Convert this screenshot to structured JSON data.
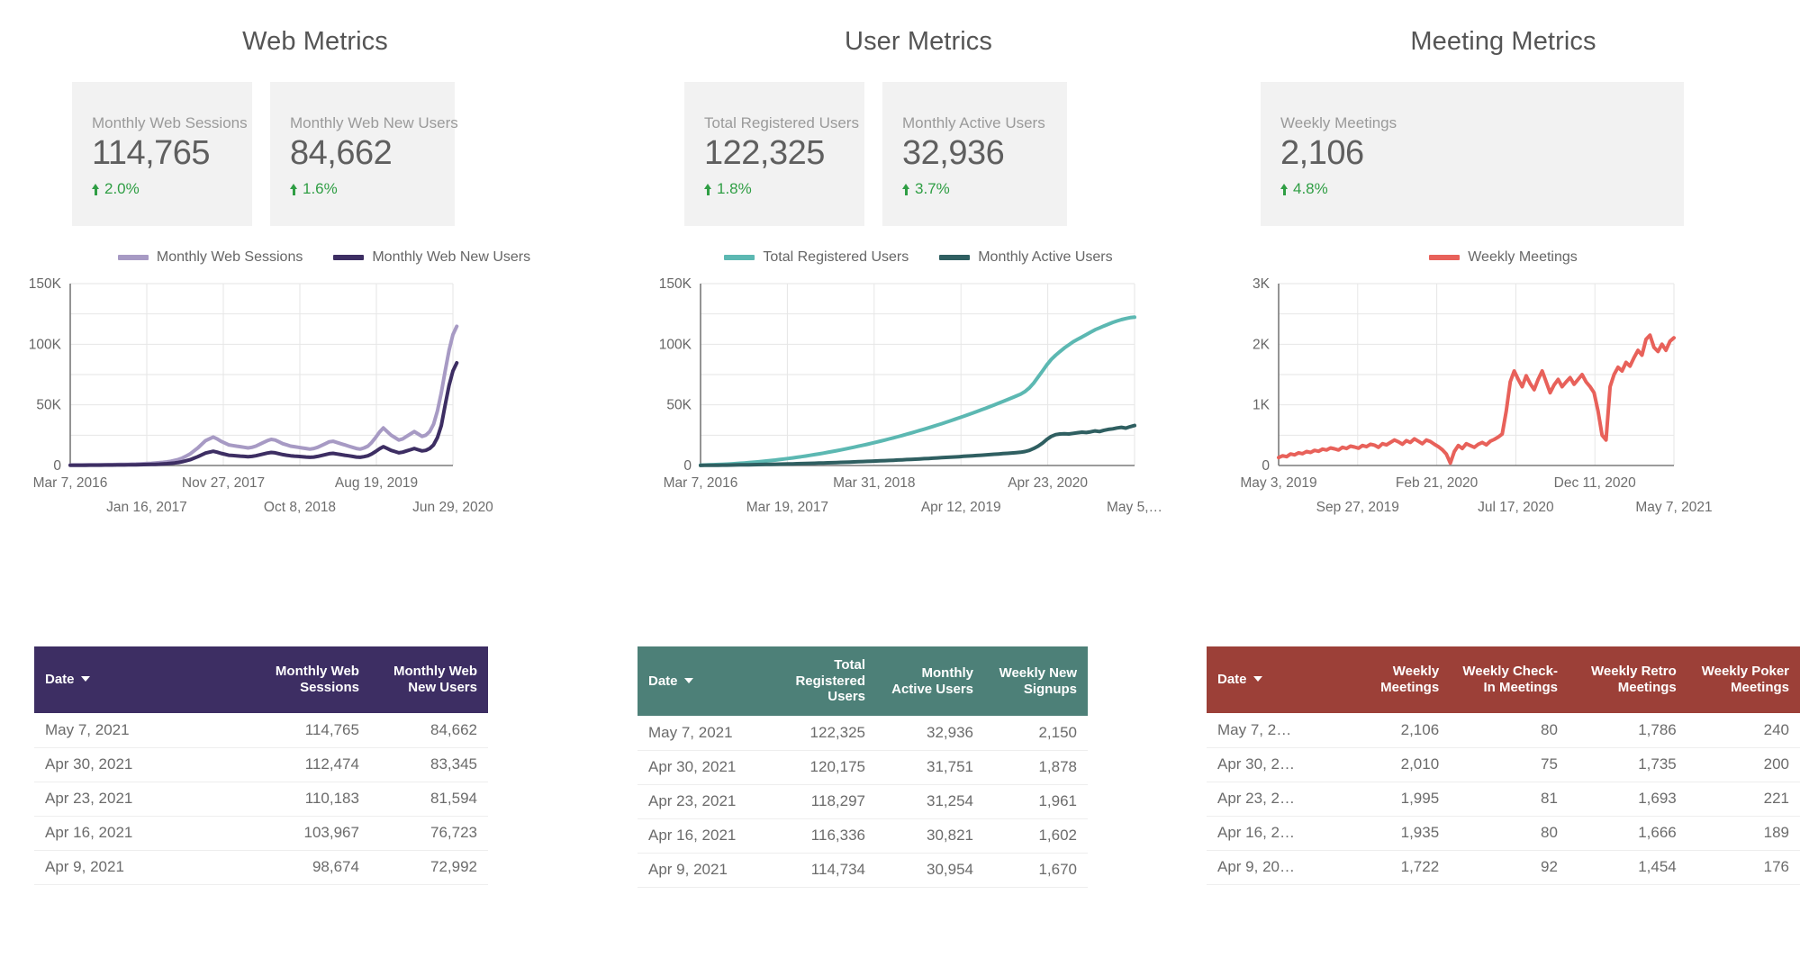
{
  "panels": [
    {
      "id": "web",
      "title": "Web Metrics",
      "accent": "#3d2e63",
      "kpis": [
        {
          "label": "Monthly Web Sessions",
          "value": "114,765",
          "delta": "2.0%",
          "trend": "up"
        },
        {
          "label": "Monthly Web New Users",
          "value": "84,662",
          "delta": "1.6%",
          "trend": "up"
        }
      ],
      "legend": [
        {
          "label": "Monthly Web Sessions",
          "color": "#a79ac4"
        },
        {
          "label": "Monthly Web New Users",
          "color": "#3d2e63"
        }
      ],
      "table": {
        "columns": [
          "Date",
          "Monthly Web Sessions",
          "Monthly Web New Users"
        ],
        "sort_column": "Date",
        "rows": [
          [
            "May 7, 2021",
            "114,765",
            "84,662"
          ],
          [
            "Apr 30, 2021",
            "112,474",
            "83,345"
          ],
          [
            "Apr 23, 2021",
            "110,183",
            "81,594"
          ],
          [
            "Apr 16, 2021",
            "103,967",
            "76,723"
          ],
          [
            "Apr 9, 2021",
            "98,674",
            "72,992"
          ]
        ]
      }
    },
    {
      "id": "user",
      "title": "User Metrics",
      "accent": "#4d8078",
      "kpis": [
        {
          "label": "Total Registered Users",
          "value": "122,325",
          "delta": "1.8%",
          "trend": "up"
        },
        {
          "label": "Monthly Active Users",
          "value": "32,936",
          "delta": "3.7%",
          "trend": "up"
        }
      ],
      "legend": [
        {
          "label": "Total Registered Users",
          "color": "#5cb8b2"
        },
        {
          "label": "Monthly Active Users",
          "color": "#2f5f61"
        }
      ],
      "table": {
        "columns": [
          "Date",
          "Total Registered Users",
          "Monthly Active Users",
          "Weekly New Signups"
        ],
        "sort_column": "Date",
        "rows": [
          [
            "May 7, 2021",
            "122,325",
            "32,936",
            "2,150"
          ],
          [
            "Apr 30, 2021",
            "120,175",
            "31,751",
            "1,878"
          ],
          [
            "Apr 23, 2021",
            "118,297",
            "31,254",
            "1,961"
          ],
          [
            "Apr 16, 2021",
            "116,336",
            "30,821",
            "1,602"
          ],
          [
            "Apr 9, 2021",
            "114,734",
            "30,954",
            "1,670"
          ]
        ]
      }
    },
    {
      "id": "meet",
      "title": "Meeting Metrics",
      "accent": "#9c4038",
      "kpis": [
        {
          "label": "Weekly Meetings",
          "value": "2,106",
          "delta": "4.8%",
          "trend": "up"
        }
      ],
      "legend": [
        {
          "label": "Weekly Meetings",
          "color": "#e8615a"
        }
      ],
      "table": {
        "columns": [
          "Date",
          "Weekly Meetings",
          "Weekly Check-In Meetings",
          "Weekly Retro Meetings",
          "Weekly Poker Meetings"
        ],
        "sort_column": "Date",
        "rows": [
          [
            "May 7, 2…",
            "2,106",
            "80",
            "1,786",
            "240"
          ],
          [
            "Apr 30, 2…",
            "2,010",
            "75",
            "1,735",
            "200"
          ],
          [
            "Apr 23, 2…",
            "1,995",
            "81",
            "1,693",
            "221"
          ],
          [
            "Apr 16, 2…",
            "1,935",
            "80",
            "1,666",
            "189"
          ],
          [
            "Apr 9, 20…",
            "1,722",
            "92",
            "1,454",
            "176"
          ]
        ]
      }
    }
  ],
  "chart_data": [
    {
      "id": "web-chart",
      "type": "line",
      "title": "Web Metrics",
      "xlabel": "",
      "ylabel": "",
      "ylim": [
        0,
        150000
      ],
      "ytick_labels": [
        "0",
        "50K",
        "100K",
        "150K"
      ],
      "ytick_values": [
        0,
        50000,
        100000,
        150000
      ],
      "grid": true,
      "legend_position": "top",
      "xtick_labels": [
        "Mar 7, 2016",
        "Jan 16, 2017",
        "Nov 27, 2017",
        "Oct 8, 2018",
        "Aug 19, 2019",
        "Jun 29, 2020"
      ],
      "x": [
        0,
        1,
        2,
        3,
        4,
        5,
        6,
        7,
        8,
        9,
        10,
        11,
        12,
        13,
        14,
        15,
        16,
        17,
        18,
        19,
        20,
        21,
        22,
        23,
        24,
        25,
        26,
        27,
        28,
        29,
        30,
        31,
        32,
        33,
        34,
        35,
        36,
        37,
        38,
        39,
        40,
        41,
        42,
        43,
        44,
        45,
        46,
        47,
        48,
        49,
        50,
        51,
        52,
        53,
        54,
        55,
        56,
        57,
        58,
        59,
        60,
        61,
        62,
        63,
        64,
        65,
        66,
        67,
        68,
        69,
        70,
        71,
        72,
        73,
        74,
        75,
        76,
        77,
        78,
        79,
        80,
        81,
        82,
        83,
        84,
        85,
        86,
        87,
        88,
        89,
        90,
        91,
        92,
        93,
        94,
        95,
        96,
        97,
        98,
        99
      ],
      "series": [
        {
          "name": "Monthly Web Sessions",
          "color": "#a79ac4",
          "values": [
            400,
            420,
            450,
            470,
            500,
            520,
            560,
            600,
            640,
            680,
            720,
            760,
            820,
            880,
            940,
            1000,
            1100,
            1200,
            1300,
            1450,
            1600,
            1800,
            2000,
            2300,
            2600,
            3000,
            3500,
            4200,
            5000,
            6200,
            7800,
            9500,
            12000,
            14500,
            17500,
            20500,
            22000,
            23500,
            22000,
            20000,
            18500,
            17000,
            16500,
            16000,
            15500,
            15000,
            14500,
            15000,
            16000,
            17500,
            19000,
            20500,
            21500,
            21000,
            19500,
            18000,
            17000,
            16000,
            15500,
            15000,
            14500,
            14000,
            13500,
            14000,
            15000,
            16500,
            18000,
            19500,
            20000,
            19000,
            18000,
            17000,
            16000,
            15000,
            14000,
            13500,
            14500,
            16000,
            19000,
            23000,
            27500,
            31000,
            28000,
            25000,
            23000,
            21000,
            22000,
            24000,
            26000,
            28000,
            26000,
            24000,
            25000,
            28000,
            34000,
            45000,
            60000,
            78000,
            95000,
            108000,
            114765
          ]
        },
        {
          "name": "Monthly Web New Users",
          "color": "#3d2e63",
          "values": [
            200,
            210,
            225,
            235,
            250,
            260,
            280,
            300,
            320,
            340,
            360,
            380,
            410,
            440,
            470,
            500,
            550,
            600,
            650,
            725,
            800,
            900,
            1000,
            1150,
            1300,
            1500,
            1750,
            2100,
            2500,
            3100,
            3900,
            4750,
            6000,
            7250,
            8750,
            10250,
            11000,
            11750,
            11000,
            10000,
            9250,
            8500,
            8250,
            8000,
            7750,
            7500,
            7250,
            7500,
            8000,
            8750,
            9500,
            10250,
            10750,
            10500,
            9750,
            9000,
            8500,
            8000,
            7750,
            7500,
            7250,
            7000,
            6750,
            7000,
            7500,
            8250,
            9000,
            9750,
            10000,
            9500,
            9000,
            8500,
            8000,
            7500,
            7000,
            6750,
            7250,
            8000,
            9500,
            11500,
            13750,
            15500,
            14000,
            12500,
            11500,
            10500,
            11000,
            12000,
            13000,
            14000,
            13000,
            12000,
            12500,
            14000,
            17000,
            23000,
            33000,
            50000,
            66000,
            78000,
            84662
          ]
        }
      ]
    },
    {
      "id": "user-chart",
      "type": "line",
      "title": "User Metrics",
      "xlabel": "",
      "ylabel": "",
      "ylim": [
        0,
        150000
      ],
      "ytick_labels": [
        "0",
        "50K",
        "100K",
        "150K"
      ],
      "ytick_values": [
        0,
        50000,
        100000,
        150000
      ],
      "grid": true,
      "legend_position": "top",
      "xtick_labels": [
        "Mar 7, 2016",
        "Mar 19, 2017",
        "Mar 31, 2018",
        "Apr 12, 2019",
        "Apr 23, 2020",
        "May 5,…"
      ],
      "x": [
        0,
        1,
        2,
        3,
        4,
        5,
        6,
        7,
        8,
        9,
        10,
        11,
        12,
        13,
        14,
        15,
        16,
        17,
        18,
        19,
        20,
        21,
        22,
        23,
        24,
        25,
        26,
        27,
        28,
        29,
        30,
        31,
        32,
        33,
        34,
        35,
        36,
        37,
        38,
        39,
        40,
        41,
        42,
        43,
        44,
        45,
        46,
        47,
        48,
        49,
        50,
        51,
        52,
        53,
        54,
        55,
        56,
        57,
        58,
        59,
        60,
        61,
        62,
        63,
        64,
        65,
        66,
        67,
        68,
        69,
        70,
        71,
        72,
        73,
        74,
        75,
        76,
        77,
        78,
        79,
        80,
        81,
        82,
        83,
        84,
        85,
        86,
        87,
        88,
        89,
        90,
        91,
        92,
        93,
        94,
        95,
        96,
        97,
        98,
        99
      ],
      "series": [
        {
          "name": "Total Registered Users",
          "color": "#5cb8b2",
          "values": [
            300,
            400,
            520,
            650,
            800,
            960,
            1150,
            1350,
            1580,
            1820,
            2080,
            2360,
            2660,
            2980,
            3320,
            3680,
            4060,
            4460,
            4880,
            5320,
            5780,
            6260,
            6760,
            7280,
            7820,
            8380,
            8960,
            9560,
            10180,
            10820,
            11480,
            12160,
            12860,
            13580,
            14320,
            15080,
            15860,
            16660,
            17480,
            18320,
            19180,
            20060,
            20960,
            21880,
            22820,
            23780,
            24760,
            25760,
            26780,
            27820,
            28880,
            29960,
            31060,
            32180,
            33320,
            34480,
            35660,
            36860,
            38080,
            39320,
            40580,
            41860,
            43160,
            44480,
            45820,
            47180,
            48560,
            49960,
            51380,
            52820,
            54280,
            55760,
            57260,
            58780,
            61000,
            64000,
            68000,
            73000,
            78000,
            83000,
            87500,
            91000,
            94000,
            97000,
            99500,
            102000,
            104000,
            106000,
            108000,
            110000,
            112000,
            113500,
            115000,
            116500,
            118000,
            119200,
            120300,
            121200,
            121900,
            122325
          ]
        },
        {
          "name": "Monthly Active Users",
          "color": "#2f5f61",
          "values": [
            100,
            130,
            165,
            200,
            240,
            285,
            330,
            380,
            430,
            485,
            545,
            605,
            670,
            735,
            805,
            875,
            950,
            1030,
            1110,
            1195,
            1280,
            1370,
            1465,
            1560,
            1660,
            1760,
            1865,
            1975,
            2085,
            2200,
            2320,
            2440,
            2565,
            2695,
            2825,
            2960,
            3100,
            3240,
            3385,
            3535,
            3690,
            3845,
            4005,
            4170,
            4340,
            4510,
            4685,
            4865,
            5050,
            5235,
            5425,
            5620,
            5820,
            6020,
            6225,
            6435,
            6650,
            6865,
            7085,
            7310,
            7540,
            7775,
            8010,
            8250,
            8495,
            8745,
            9000,
            9255,
            9515,
            9780,
            10050,
            10325,
            10600,
            10880,
            11500,
            12500,
            14000,
            16000,
            18500,
            21500,
            24000,
            25500,
            26000,
            26200,
            26000,
            26500,
            27000,
            27500,
            27200,
            27800,
            28500,
            28000,
            29000,
            29800,
            30200,
            31000,
            31500,
            30800,
            32000,
            32936
          ]
        }
      ]
    },
    {
      "id": "meeting-chart",
      "type": "line",
      "title": "Meeting Metrics",
      "xlabel": "",
      "ylabel": "",
      "ylim": [
        0,
        3000
      ],
      "ytick_labels": [
        "0",
        "1K",
        "2K",
        "3K"
      ],
      "ytick_values": [
        0,
        1000,
        2000,
        3000
      ],
      "grid": true,
      "legend_position": "top",
      "xtick_labels": [
        "May 3, 2019",
        "Sep 27, 2019",
        "Feb 21, 2020",
        "Jul 17, 2020",
        "Dec 11, 2020",
        "May 7, 2021"
      ],
      "x": [
        0,
        1,
        2,
        3,
        4,
        5,
        6,
        7,
        8,
        9,
        10,
        11,
        12,
        13,
        14,
        15,
        16,
        17,
        18,
        19,
        20,
        21,
        22,
        23,
        24,
        25,
        26,
        27,
        28,
        29,
        30,
        31,
        32,
        33,
        34,
        35,
        36,
        37,
        38,
        39,
        40,
        41,
        42,
        43,
        44,
        45,
        46,
        47,
        48,
        49,
        50,
        51,
        52,
        53,
        54,
        55,
        56,
        57,
        58,
        59,
        60,
        61,
        62,
        63,
        64,
        65,
        66,
        67,
        68,
        69,
        70,
        71,
        72,
        73,
        74,
        75,
        76,
        77,
        78,
        79,
        80,
        81,
        82,
        83,
        84,
        85,
        86,
        87,
        88,
        89,
        90,
        91,
        92,
        93,
        94,
        95,
        96,
        97,
        98,
        99
      ],
      "series": [
        {
          "name": "Weekly Meetings",
          "color": "#e8615a",
          "values": [
            130,
            160,
            145,
            190,
            175,
            210,
            195,
            230,
            215,
            250,
            235,
            270,
            255,
            290,
            275,
            255,
            300,
            280,
            320,
            305,
            285,
            330,
            310,
            350,
            335,
            300,
            360,
            340,
            380,
            420,
            390,
            350,
            410,
            380,
            440,
            400,
            360,
            420,
            395,
            350,
            310,
            260,
            190,
            40,
            230,
            330,
            280,
            360,
            330,
            300,
            350,
            380,
            340,
            400,
            430,
            470,
            520,
            900,
            1380,
            1560,
            1420,
            1300,
            1480,
            1350,
            1250,
            1420,
            1560,
            1380,
            1200,
            1330,
            1420,
            1300,
            1380,
            1450,
            1340,
            1420,
            1500,
            1380,
            1300,
            1200,
            900,
            500,
            420,
            1300,
            1500,
            1620,
            1560,
            1700,
            1640,
            1780,
            1900,
            1820,
            2080,
            2150,
            1950,
            1880,
            2000,
            1900,
            2050,
            2106
          ]
        }
      ]
    }
  ]
}
